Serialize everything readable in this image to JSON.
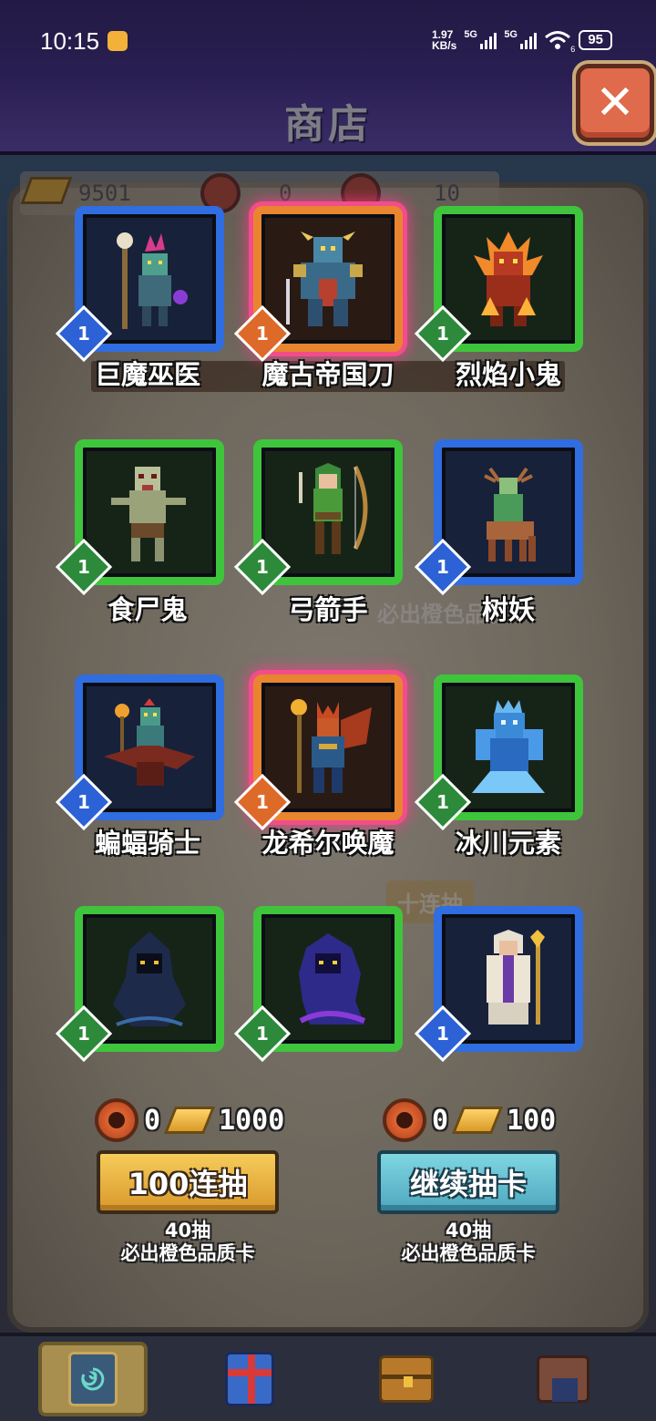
{
  "status_bar": {
    "time": "10:15",
    "net_speed_value": "1.97",
    "net_speed_unit": "KB/s",
    "sim1_label": "5G",
    "sim2_label": "5G",
    "wifi_label": "6",
    "battery": "95"
  },
  "header": {
    "title": "商店",
    "close_icon": "close-icon"
  },
  "currency": {
    "gold": "9501",
    "token": "0",
    "tickets": "10"
  },
  "cards": [
    {
      "name": "巨魔巫医",
      "rarity": "blue",
      "level": "1"
    },
    {
      "name": "魔古帝国刀",
      "rarity": "orange",
      "level": "1"
    },
    {
      "name": "烈焰小鬼",
      "rarity": "green",
      "level": "1"
    },
    {
      "name": "食尸鬼",
      "rarity": "green",
      "level": "1"
    },
    {
      "name": "弓箭手",
      "rarity": "green",
      "level": "1"
    },
    {
      "name": "树妖",
      "rarity": "blue",
      "level": "1"
    },
    {
      "name": "蝙蝠骑士",
      "rarity": "blue",
      "level": "1"
    },
    {
      "name": "龙希尔唤魔",
      "rarity": "orange",
      "level": "1"
    },
    {
      "name": "冰川元素",
      "rarity": "green",
      "level": "1"
    },
    {
      "name": "",
      "rarity": "green",
      "level": "1"
    },
    {
      "name": "",
      "rarity": "green",
      "level": "1"
    },
    {
      "name": "",
      "rarity": "blue",
      "level": "1"
    }
  ],
  "background_text": {
    "guarantee_ghost": "必出橙色品质",
    "ten_draw_ghost": "十连抽"
  },
  "draw_options": [
    {
      "token_cost": "0",
      "gold_cost": "1000",
      "button_label": "100连抽",
      "note_line1": "40抽",
      "note_line2": "必出橙色品质卡"
    },
    {
      "token_cost": "0",
      "gold_cost": "100",
      "button_label": "继续抽卡",
      "note_line1": "40抽",
      "note_line2": "必出橙色品质卡"
    }
  ],
  "bottom_nav": [
    {
      "icon": "card-deck-icon",
      "active": true
    },
    {
      "icon": "gift-box-icon",
      "active": false
    },
    {
      "icon": "treasure-chest-icon",
      "active": false
    },
    {
      "icon": "horned-house-icon",
      "active": false
    }
  ],
  "colors": {
    "rarity_blue": "#2f6de0",
    "rarity_green": "#3ec53c",
    "rarity_orange": "#e8852e",
    "highlight_glow": "#f24d8a",
    "button_gold": "#f6cc5a",
    "button_teal": "#7fd6e2"
  }
}
